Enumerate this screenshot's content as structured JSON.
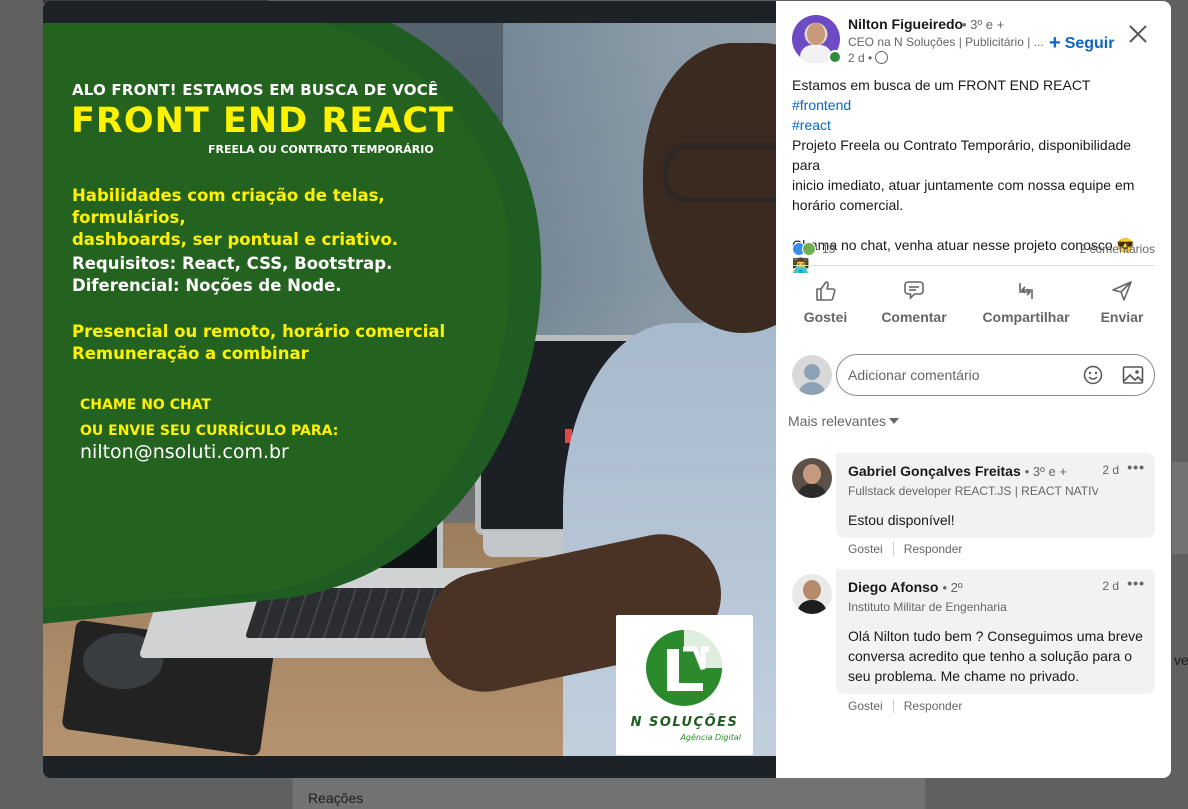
{
  "background": {
    "section_label": "Reações",
    "right_fragment": "vel"
  },
  "post_image": {
    "callout": "ALO FRONT! ESTAMOS EM BUSCA DE VOCÊ",
    "title": "FRONT END REACT",
    "subtitle": "FREELA OU CONTRATO TEMPORÁRIO",
    "skills": [
      "Habilidades com criação de telas, formulários,",
      "dashboards, ser pontual e criativo."
    ],
    "requirements": [
      "Requisitos: React, CSS, Bootstrap.",
      "Diferencial: Noções de Node."
    ],
    "mode": [
      "Presencial ou remoto, horário comercial",
      "Remuneração a combinar"
    ],
    "chat": [
      "CHAME NO CHAT",
      "OU ENVIE SEU CURRÍCULO PARA:"
    ],
    "email": "nilton@nsoluti.com.br",
    "logo_name": "N SOLUÇÕES",
    "logo_tagline": "Agência Digital",
    "brand_green": "#1f5d22",
    "accent_yellow": "#fff200"
  },
  "author": {
    "name": "Nilton Figueiredo",
    "degree": "• 3º e +",
    "headline": "CEO na N Soluções | Publicitário | ...",
    "time": "2 d •",
    "follow_label": "Seguir",
    "follow_plus": "+"
  },
  "post": {
    "line1": "Estamos em busca de um FRONT END REACT ",
    "tag1": "#frontend",
    "tag2": "#react",
    "line2": "Projeto Freela ou Contrato Temporário, disponibilidade para",
    "line3": "inicio imediato, atuar juntamente com nossa equipe em horário comercial.",
    "line4": "Chama no chat, venha atuar nesse projeto conosco 😎 👨‍💻"
  },
  "stats": {
    "reactions": "13",
    "comments": "2 comentários"
  },
  "actions": {
    "like": "Gostei",
    "comment": "Comentar",
    "share": "Compartilhar",
    "send": "Enviar"
  },
  "comment_box": {
    "placeholder": "Adicionar comentário"
  },
  "sort": {
    "label": "Mais relevantes"
  },
  "comments": [
    {
      "name": "Gabriel Gonçalves Freitas",
      "degree": "• 3º e +",
      "time": "2 d",
      "more": "•••",
      "headline": "Fullstack developer REACT.JS | REACT NATIV...",
      "body": "Estou disponível!",
      "like_label": "Gostei",
      "reply_label": "Responder"
    },
    {
      "name": "Diego Afonso",
      "degree": "• 2º",
      "time": "2 d",
      "more": "•••",
      "headline": "Instituto Militar de Engenharia",
      "body": "Olá Nilton tudo bem ? Conseguimos uma breve conversa acredito que tenho a solução para o seu problema. Me chame no privado.",
      "like_label": "Gostei",
      "reply_label": "Responder"
    }
  ]
}
